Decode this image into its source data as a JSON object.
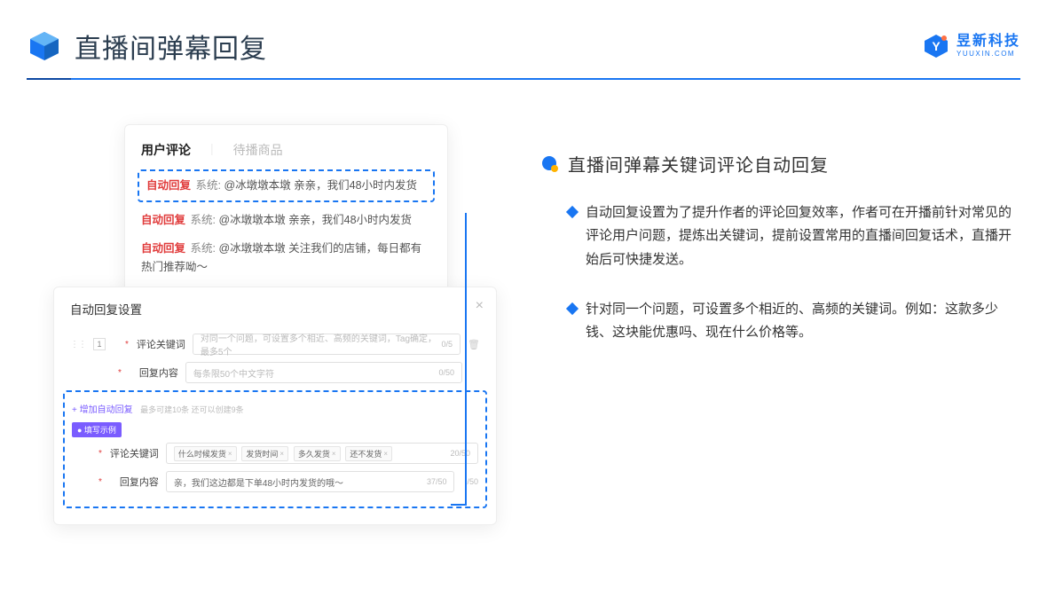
{
  "header": {
    "title": "直播间弹幕回复",
    "logo_cn": "昱新科技",
    "logo_en": "YUUXIN.COM"
  },
  "comments": {
    "tabs": {
      "active": "用户评论",
      "inactive": "待播商品"
    },
    "highlighted": {
      "tag": "自动回复",
      "sys": "系统:",
      "text": "@冰墩墩本墩 亲亲，我们48小时内发货"
    },
    "others": [
      {
        "tag": "自动回复",
        "sys": "系统:",
        "text": "@冰墩墩本墩 亲亲，我们48小时内发货"
      },
      {
        "tag": "自动回复",
        "sys": "系统:",
        "text": "@冰墩墩本墩 关注我们的店铺，每日都有热门推荐呦～"
      }
    ]
  },
  "settings": {
    "title": "自动回复设置",
    "index": "1",
    "rows": {
      "kw_label": "评论关键词",
      "kw_placeholder": "对同一个问题，可设置多个相近、高频的关键词，Tag确定，最多5个",
      "kw_counter": "0/5",
      "reply_label": "回复内容",
      "reply_placeholder": "每条限50个中文字符",
      "reply_counter": "0/50"
    },
    "add": {
      "link": "+ 增加自动回复",
      "hint": "最多可建10条 还可以创建9条"
    },
    "example": {
      "badge": "● 填写示例",
      "kw_label": "评论关键词",
      "kw_tags": [
        "什么时候发货",
        "发货时间",
        "多久发货",
        "还不发货"
      ],
      "kw_counter": "20/50",
      "reply_label": "回复内容",
      "reply_value": "亲，我们这边都是下单48小时内发货的哦～",
      "reply_counter": "37/50",
      "side_counter": "/50"
    }
  },
  "right": {
    "section_title": "直播间弹幕关键词评论自动回复",
    "bullets": [
      "自动回复设置为了提升作者的评论回复效率，作者可在开播前针对常见的评论用户问题，提炼出关键词，提前设置常用的直播间回复话术，直播开始后可快捷发送。",
      "针对同一个问题，可设置多个相近的、高频的关键词。例如：这款多少钱、这块能优惠吗、现在什么价格等。"
    ]
  }
}
